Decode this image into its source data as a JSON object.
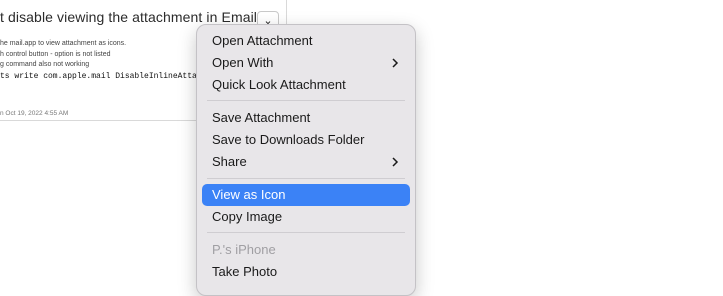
{
  "email": {
    "title": "t disable viewing the attachment in Emails.",
    "expand_glyph": "⌄",
    "lines": [
      "he mail.app to view attachment as icons.",
      "h control button - option is not listed",
      "g command also not working"
    ],
    "code": "ts write com.apple.mail DisableInlineAttachmentV",
    "date": "n Oct 19, 2022 4:55 AM"
  },
  "menu": {
    "open_attachment": "Open Attachment",
    "open_with": "Open With",
    "quick_look": "Quick Look Attachment",
    "save_attachment": "Save Attachment",
    "save_downloads": "Save to Downloads Folder",
    "share": "Share",
    "view_as_icon": "View as Icon",
    "copy_image": "Copy Image",
    "device": "P.'s iPhone",
    "take_photo": "Take Photo"
  },
  "colors": {
    "highlight": "#3b82f6",
    "menu_background": "#e8e6e9",
    "disabled_text": "#a09fa3"
  }
}
